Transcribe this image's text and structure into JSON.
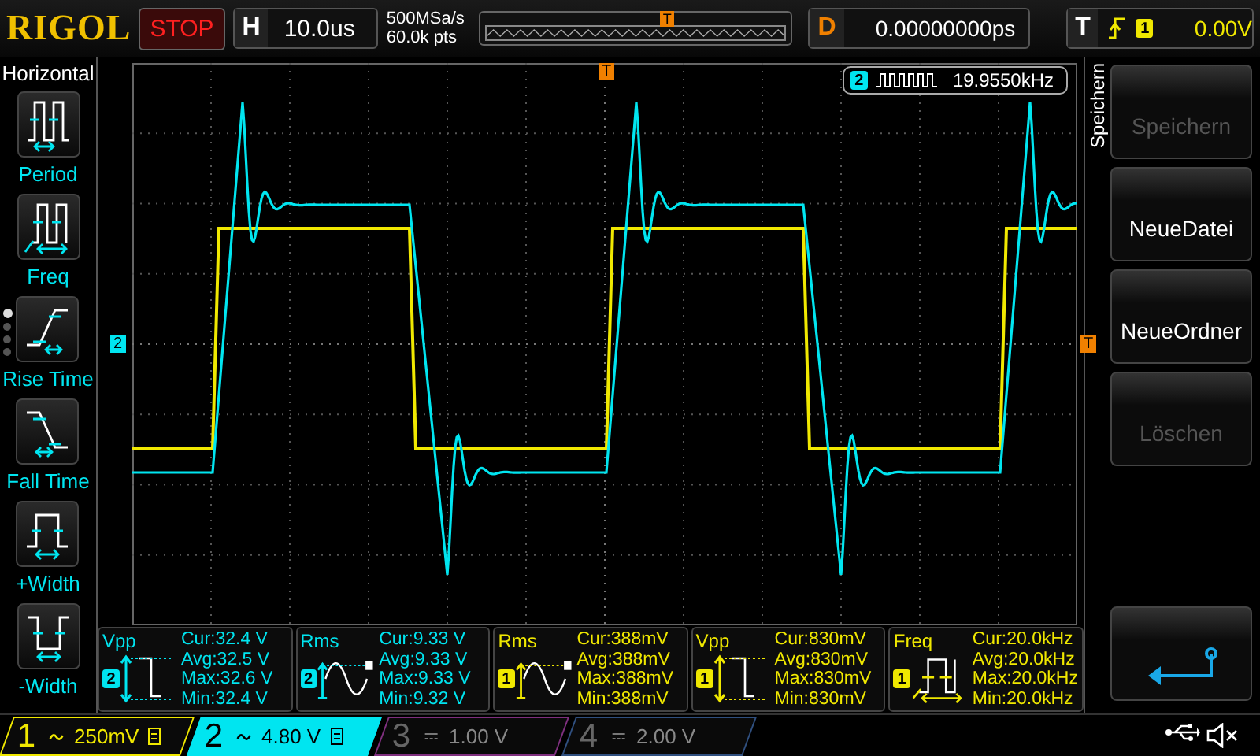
{
  "brand": "RIGOL",
  "run_state": "STOP",
  "horizontal": {
    "label": "H",
    "timebase": "10.0us",
    "sample_rate": "500MSa/s",
    "memory_depth": "60.0k pts"
  },
  "overview": {
    "trigger_marker": "T"
  },
  "delay": {
    "label": "D",
    "value": "0.00000000ps"
  },
  "trigger": {
    "label": "T",
    "source": "1",
    "level": "0.00V"
  },
  "left_menu": {
    "title": "Horizontal",
    "pages": [
      {
        "selected": true
      },
      {
        "selected": false
      },
      {
        "selected": false
      },
      {
        "selected": false
      }
    ],
    "items": [
      {
        "kind": "period",
        "label": "Period"
      },
      {
        "kind": "freq",
        "label": "Freq"
      },
      {
        "kind": "rise",
        "label": "Rise Time"
      },
      {
        "kind": "fall",
        "label": "Fall Time"
      },
      {
        "kind": "pwidth",
        "label": "+Width"
      },
      {
        "kind": "nwidth",
        "label": "-Width"
      }
    ]
  },
  "screen": {
    "markers": [
      {
        "kind": "trigger_position",
        "text": "T"
      },
      {
        "kind": "channel",
        "text": "2",
        "color": "#00e5f0"
      },
      {
        "kind": "trigger_level",
        "text": "T"
      }
    ],
    "counter": {
      "channel": "2",
      "value": "19.9550kHz"
    }
  },
  "measurements": [
    {
      "kind": "vpp",
      "name": "Vpp",
      "channel": "2",
      "color": "#00e5f0",
      "lines": [
        "Cur:32.4 V",
        "Avg:32.5 V",
        "Max:32.6 V",
        "Min:32.4 V"
      ]
    },
    {
      "kind": "rms",
      "name": "Rms",
      "channel": "2",
      "color": "#00e5f0",
      "lines": [
        "Cur:9.33 V",
        "Avg:9.33 V",
        "Max:9.33 V",
        "Min:9.32 V"
      ]
    },
    {
      "kind": "rms",
      "name": "Rms",
      "channel": "1",
      "color": "#f0e800",
      "lines": [
        "Cur:388mV",
        "Avg:388mV",
        "Max:388mV",
        "Min:388mV"
      ]
    },
    {
      "kind": "vpp",
      "name": "Vpp",
      "channel": "1",
      "color": "#f0e800",
      "lines": [
        "Cur:830mV",
        "Avg:830mV",
        "Max:830mV",
        "Min:830mV"
      ]
    },
    {
      "kind": "freq",
      "name": "Freq",
      "channel": "1",
      "color": "#f0e800",
      "lines": [
        "Cur:20.0kHz",
        "Avg:20.0kHz",
        "Max:20.0kHz",
        "Min:20.0kHz"
      ]
    }
  ],
  "right_menu": {
    "title": "Speichern",
    "buttons": [
      {
        "kind": "text",
        "label": "Speichern",
        "disabled": true
      },
      {
        "kind": "text",
        "label": "NeueDatei",
        "disabled": false
      },
      {
        "kind": "text",
        "label": "NeueOrdner",
        "disabled": false
      },
      {
        "kind": "text",
        "label": "Löschen",
        "disabled": true
      },
      {
        "kind": "back",
        "disabled": false
      }
    ]
  },
  "channels": [
    {
      "number": "1",
      "kind": "ac",
      "scale": "250mV",
      "on": true,
      "selected": false,
      "color": "#f0e800"
    },
    {
      "number": "2",
      "kind": "ac",
      "scale": "4.80 V",
      "on": true,
      "selected": true,
      "color": "#00e5f0"
    },
    {
      "number": "3",
      "kind": "dc",
      "scale": "1.00 V",
      "on": false,
      "selected": false,
      "color": "#803080"
    },
    {
      "number": "4",
      "kind": "dc",
      "scale": "2.00 V",
      "on": false,
      "selected": false,
      "color": "#305080"
    }
  ]
}
